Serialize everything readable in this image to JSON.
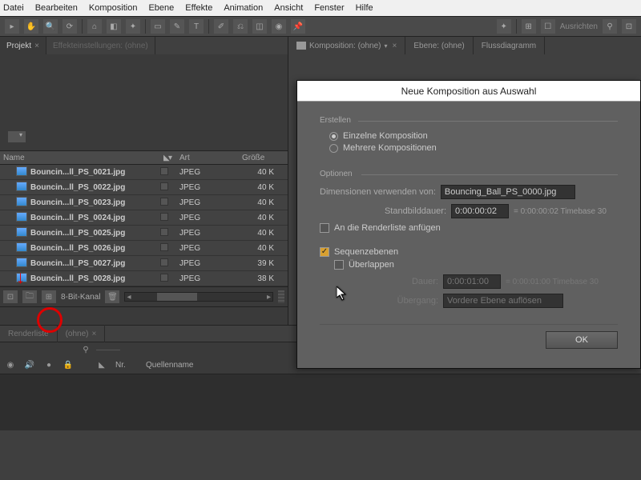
{
  "menu": [
    "Datei",
    "Bearbeiten",
    "Komposition",
    "Ebene",
    "Effekte",
    "Animation",
    "Ansicht",
    "Fenster",
    "Hilfe"
  ],
  "toolbar_right": "Ausrichten",
  "left_tabs": {
    "project": "Projekt",
    "effect": "Effekteinstellungen: (ohne)"
  },
  "cols": {
    "name": "Name",
    "art": "Art",
    "size": "Größe"
  },
  "files": [
    {
      "name": "Bouncin...ll_PS_0021.jpg",
      "art": "JPEG",
      "size": "40 K"
    },
    {
      "name": "Bouncin...ll_PS_0022.jpg",
      "art": "JPEG",
      "size": "40 K"
    },
    {
      "name": "Bouncin...ll_PS_0023.jpg",
      "art": "JPEG",
      "size": "40 K"
    },
    {
      "name": "Bouncin...ll_PS_0024.jpg",
      "art": "JPEG",
      "size": "40 K"
    },
    {
      "name": "Bouncin...ll_PS_0025.jpg",
      "art": "JPEG",
      "size": "40 K"
    },
    {
      "name": "Bouncin...ll_PS_0026.jpg",
      "art": "JPEG",
      "size": "40 K"
    },
    {
      "name": "Bouncin...ll_PS_0027.jpg",
      "art": "JPEG",
      "size": "39 K"
    },
    {
      "name": "Bouncin...ll_PS_0028.jpg",
      "art": "JPEG",
      "size": "38 K"
    }
  ],
  "bit_channel": "8-Bit-Kanal",
  "right_tabs": {
    "comp": "Komposition: (ohne)",
    "layer": "Ebene: (ohne)",
    "flow": "Flussdiagramm"
  },
  "lower_tabs": {
    "render": "Renderliste",
    "none": "(ohne)"
  },
  "timeline_cols": {
    "nr": "Nr.",
    "q": "Quellenname"
  },
  "dialog": {
    "title": "Neue Komposition aus Auswahl",
    "create": "Erstellen",
    "single": "Einzelne Komposition",
    "multi": "Mehrere Kompositionen",
    "options": "Optionen",
    "dims_from": "Dimensionen verwenden von:",
    "dims_value": "Bouncing_Ball_PS_0000.jpg",
    "still_dur": "Standbilddauer:",
    "still_val": "0:00:00:02",
    "still_hint": "= 0:00:00:02  Timebase 30",
    "add_render": "An die Renderliste anfügen",
    "sequence": "Sequenzebenen",
    "overlap": "Überlappen",
    "dur": "Dauer:",
    "dur_val": "0:00:01:00",
    "dur_hint": "= 0:00:01:00  Timebase 30",
    "transition": "Übergang:",
    "trans_val": "Vordere Ebene auflösen",
    "ok": "OK"
  }
}
